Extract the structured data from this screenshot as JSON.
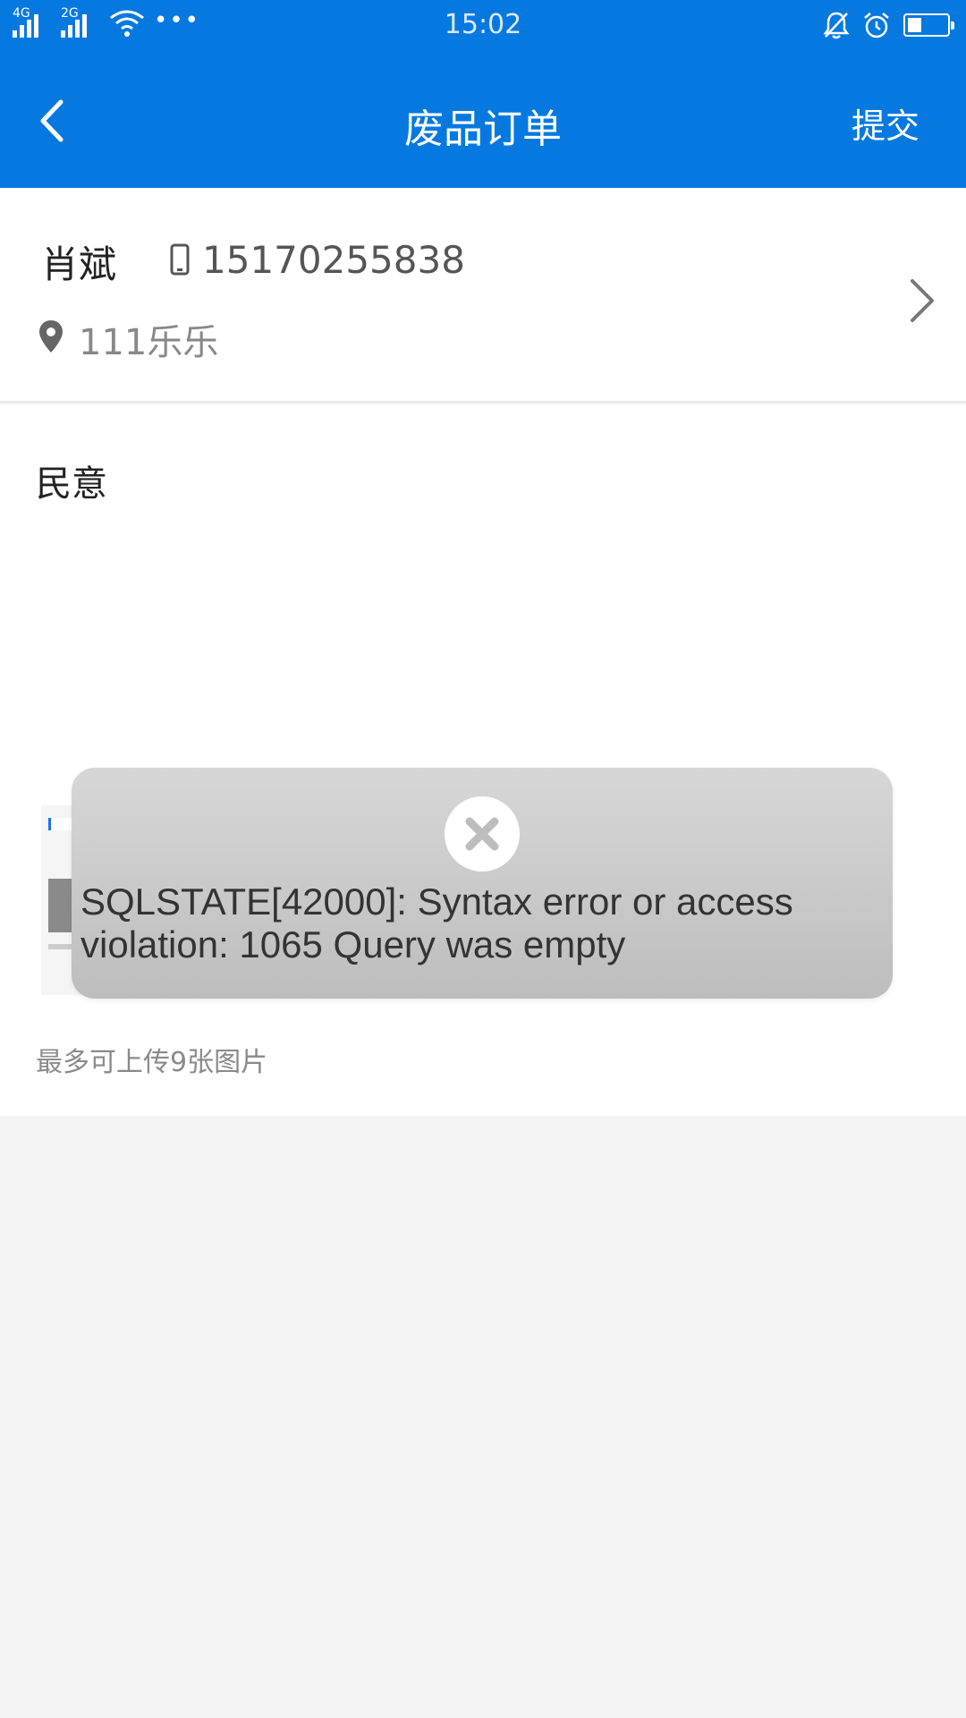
{
  "status_bar": {
    "network1": "4G",
    "network2": "2G",
    "time": "15:02",
    "battery_level": 0.35
  },
  "nav": {
    "title": "废品订单",
    "submit_label": "提交"
  },
  "contact": {
    "name": "肖斌",
    "phone": "15170255838",
    "address": "111乐乐"
  },
  "form": {
    "remark": "民意",
    "upload_hint": "最多可上传9张图片"
  },
  "toast": {
    "message": "SQLSTATE[42000]: Syntax error or access violation: 1065 Query was empty"
  },
  "icons": {
    "signal": "cellular-signal-icon",
    "wifi": "wifi-icon",
    "more": "more-dots-icon",
    "mute": "bell-mute-icon",
    "alarm": "alarm-clock-icon",
    "battery": "battery-icon",
    "back": "back-arrow-icon",
    "phone": "mobile-phone-icon",
    "location": "location-pin-icon",
    "chevron": "chevron-right-icon",
    "error": "error-circle-icon"
  },
  "colors": {
    "primary": "#0679e0",
    "background": "#f3f3f3",
    "toast_bg": "#c8c8c8"
  }
}
